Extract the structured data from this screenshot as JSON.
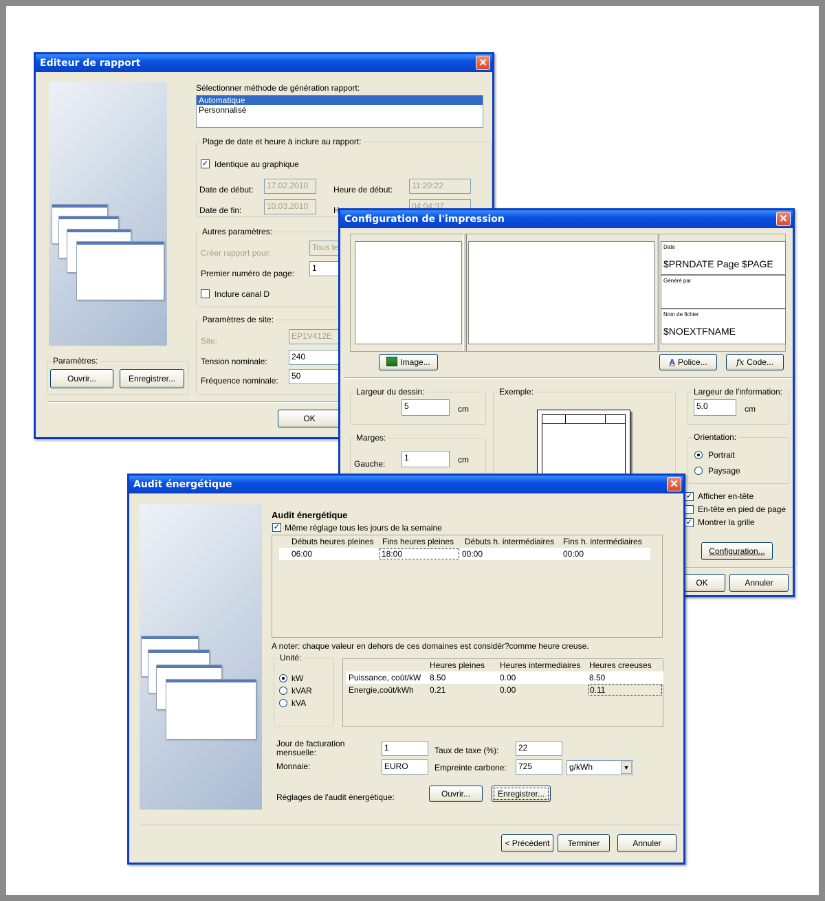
{
  "report_editor": {
    "title": "Editeur de rapport",
    "method_label": "Sélectionner méthode de génération rapport:",
    "methods": [
      "Automatique",
      "Personnalisé"
    ],
    "date_group": "Plage de date et heure à inclure au rapport:",
    "same_as_graph": "Identique au graphique",
    "start_date_label": "Date de début:",
    "start_date": "17.02.2010",
    "start_time_label": "Heure de début:",
    "start_time": "11:20:22",
    "end_date_label": "Date de fin:",
    "end_date": "10.03.2010",
    "end_time_label_visible": "H",
    "end_time": "04:04:37",
    "other_group": "Autres paramètres:",
    "create_report_for": "Créer rapport pour:",
    "create_report_value": "Tous le",
    "first_page_label": "Premier numéro de page:",
    "first_page": "1",
    "include_channel": "Inclure canal D",
    "site_group": "Paramètres de site:",
    "site_label": "Site:",
    "site_value": "EP1V412E",
    "nominal_voltage_label": "Tension nominale:",
    "nominal_voltage": "240",
    "nominal_freq_label": "Fréquence nominale:",
    "nominal_freq": "50",
    "params_group": "Paramètres:",
    "open_btn": "Ouvrir...",
    "save_btn": "Enregistrer...",
    "ok_btn": "OK"
  },
  "print_config": {
    "title": "Configuration de l'impression",
    "header_date_label": "Date",
    "header_date_value": "$PRNDATE Page $PAGE",
    "generated_by_label": "Généré par",
    "file_name_label": "Nom de fichier",
    "file_name_value": "$NOEXTFNAME",
    "image_btn": "Image...",
    "font_btn": "Police...",
    "code_btn": "Code...",
    "drawing_width_group": "Largeur du dessin:",
    "drawing_width": "5",
    "unit_cm": "cm",
    "example_group": "Exemple:",
    "info_width_group": "Largeur de l'information:",
    "info_width": "5.0",
    "margins_group": "Marges:",
    "left_label": "Gauche:",
    "left_value": "1",
    "orientation_group": "Orientation:",
    "portrait": "Portrait",
    "landscape": "Paysage",
    "show_header": "Afficher en-tête",
    "header_in_footer": "En-tête en pied de page",
    "show_grid": "Montrer la grille",
    "config_btn": "Configuration...",
    "ok_btn": "OK",
    "cancel_btn": "Annuler"
  },
  "energy_audit": {
    "title": "Audit énergétique",
    "heading": "Audit énergétique",
    "same_setting_all_days": "Même réglage tous les jours de la semaine",
    "schedule_headers": [
      "Débuts heures pleines",
      "Fins heures pleines",
      "Débuts h. intermédiaires",
      "Fins h. intermédiaires"
    ],
    "schedule_values": [
      "06:00",
      "18:00",
      "00:00",
      "00:00"
    ],
    "note": "A noter: chaque valeur en dehors de ces domaines est considér?comme heure creuse.",
    "unit_group": "Unité:",
    "units": [
      "kW",
      "kVAR",
      "kVA"
    ],
    "cost_headers": [
      "Heures pleines",
      "Heures intermediaires",
      "Heures creeuses"
    ],
    "cost_rows": [
      {
        "label": "Puissance, coût/kW",
        "values": [
          "8.50",
          "0.00",
          "8.50"
        ]
      },
      {
        "label": "Energie,coût/kWh",
        "values": [
          "0.21",
          "0.00",
          "0.11"
        ]
      }
    ],
    "billing_day_label": "Jour de facturation mensuelle:",
    "billing_day": "1",
    "tax_rate_label": "Taux de taxe (%):",
    "tax_rate": "22",
    "currency_label": "Monnaie:",
    "currency": "EURO",
    "carbon_label": "Empreinte carbone:",
    "carbon_value": "725",
    "carbon_unit": "g/kWh",
    "settings_label": "Réglages de l'audit énergétique:",
    "open_btn": "Ouvrir...",
    "save_btn": "Enregistrer...",
    "prev_btn": "< Précédent",
    "finish_btn": "Terminer",
    "cancel_btn": "Annuler"
  },
  "colors": {
    "titlebar": "#0a52e0",
    "dialog": "#ece9d8",
    "selection": "#316ac5"
  }
}
